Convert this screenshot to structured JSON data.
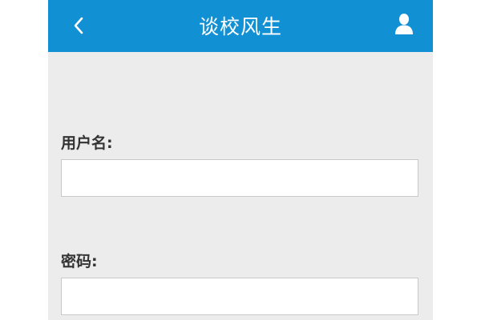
{
  "header": {
    "title": "谈校风生",
    "back_icon": "chevron-left-icon",
    "user_icon": "user-icon",
    "background_color": "#1290d4"
  },
  "form": {
    "username_label": "用户名:",
    "username_value": "",
    "username_placeholder": "",
    "password_label": "密码:",
    "password_value": "",
    "password_placeholder": ""
  },
  "colors": {
    "page_background": "#ececec",
    "input_background": "#ffffff",
    "header_text": "#ffffff"
  }
}
